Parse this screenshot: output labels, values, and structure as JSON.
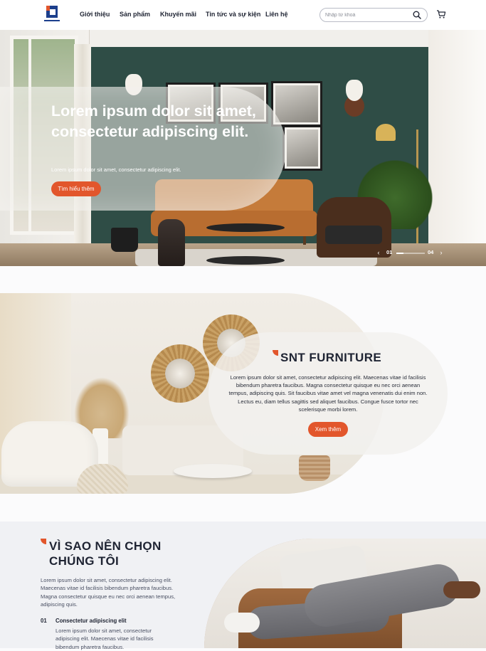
{
  "header": {
    "logo_alt": "",
    "nav": [
      "Giới thiệu",
      "Sản phẩm",
      "Khuyến mãi",
      "Tin tức và sự kiện",
      "Liên hệ"
    ],
    "search": {
      "placeholder": "Nhập từ khoá"
    },
    "icons": {
      "search": "search-icon",
      "cart": "cart-icon"
    }
  },
  "hero": {
    "title": "Lorem ipsum dolor sit amet, consectetur adipiscing elit.",
    "subtitle": "Lorem ipsum dolor sit amet, consectetur adipiscing elit.",
    "button": "Tìm hiểu thêm",
    "pager": {
      "current": "01",
      "total": "04",
      "progress": 0.25
    },
    "icons": {
      "prev": "chevron-left-icon",
      "next": "chevron-right-icon"
    }
  },
  "section_furniture": {
    "title": "SNT FURNITURE",
    "body": "Lorem ipsum dolor sit amet, consectetur adipiscing elit. Maecenas vitae id facilisis bibendum pharetra faucibus. Magna consectetur quisque eu nec orci aenean tempus, adipiscing quis. Sit faucibus vitae amet vel magna venenatis dui enim non. Lectus eu, diam tellus sagittis sed aliquet faucibus. Congue fusce tortor nec scelerisque morbi lorem.",
    "button": "Xem thêm"
  },
  "section_why": {
    "title": "VÌ SAO NÊN CHỌN CHÚNG TÔI",
    "intro": "Lorem ipsum dolor sit amet, consectetur adipiscing elit. Maecenas vitae id facilisis bibendum pharetra faucibus. Magna consectetur quisque eu nec orci aenean tempus, adipiscing quis.",
    "reasons": [
      {
        "number": "01",
        "title": "Consectetur adipiscing elit",
        "body": "Lorem ipsum dolor sit amet, consectetur adipiscing elit. Maecenas vitae id facilisis bibendum pharetra faucibus."
      }
    ]
  },
  "colors": {
    "accent": "#e2562c",
    "brand_blue": "#1c3f8c",
    "text_dark": "#1f2433",
    "hero_wall": "#2f4d46"
  }
}
